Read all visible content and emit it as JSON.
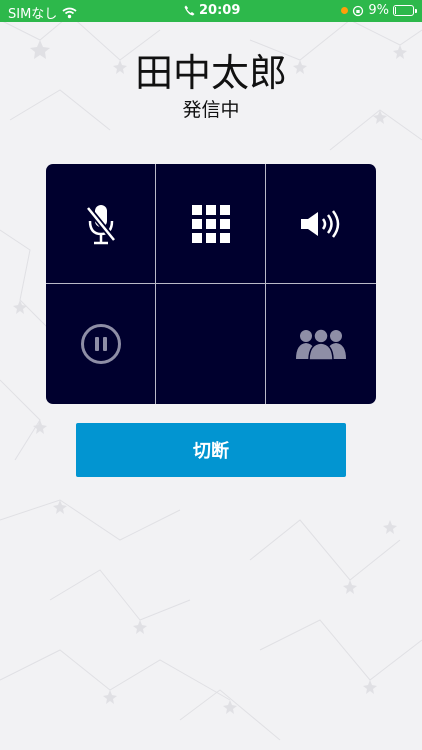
{
  "status_bar": {
    "carrier": "SIMなし",
    "time": "20:09",
    "battery": "9%",
    "battery_level": 0.09,
    "background_color": "#2db84b"
  },
  "call": {
    "caller_name": "田中太郎",
    "status": "発信中"
  },
  "controls": [
    {
      "name": "mute",
      "icon": "muted-microphone-icon",
      "enabled": true
    },
    {
      "name": "keypad",
      "icon": "keypad-grid-icon",
      "enabled": true
    },
    {
      "name": "speaker",
      "icon": "speaker-icon",
      "enabled": true
    },
    {
      "name": "hold",
      "icon": "pause-icon",
      "enabled": false
    },
    {
      "name": "empty",
      "icon": "",
      "enabled": false
    },
    {
      "name": "conference",
      "icon": "group-icon",
      "enabled": false
    }
  ],
  "hangup": {
    "label": "切断",
    "color": "#0295d1"
  },
  "colors": {
    "panel": "#00002e",
    "background": "#f2f2f4"
  }
}
